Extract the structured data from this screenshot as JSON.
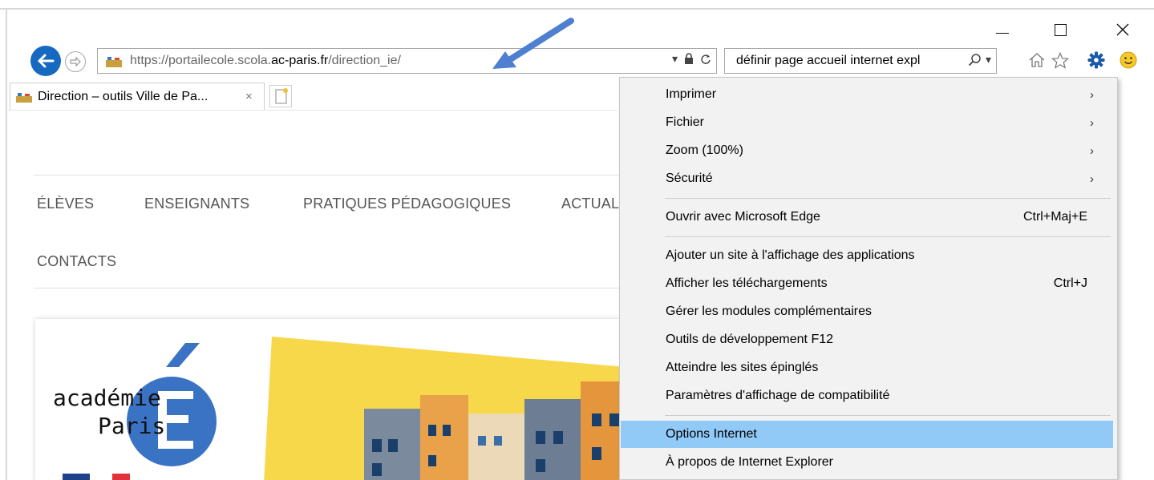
{
  "window": {
    "minimize_label": "—",
    "maximize_label": "☐",
    "close_label": "✕"
  },
  "address_bar": {
    "url_prefix": "https://portailecole.scola.",
    "url_domain": "ac-paris.fr",
    "url_suffix": "/direction_ie/"
  },
  "search_bar": {
    "value": "définir page accueil internet expl"
  },
  "tab": {
    "title": "Direction – outils Ville de Pa...",
    "close_label": "×"
  },
  "nav": {
    "items": [
      "ÉLÈVES",
      "ENSEIGNANTS",
      "PRATIQUES PÉDAGOGIQUES",
      "ACTUAL",
      "CONTACTS"
    ]
  },
  "banner": {
    "logo_line1": "académie",
    "logo_line2": "Paris"
  },
  "menu": {
    "items": [
      {
        "label": "Imprimer",
        "shortcut": "",
        "submenu": true
      },
      {
        "label": "Fichier",
        "shortcut": "",
        "submenu": true
      },
      {
        "label": "Zoom (100%)",
        "shortcut": "",
        "submenu": true
      },
      {
        "label": "Sécurité",
        "shortcut": "",
        "submenu": true
      },
      {
        "label": "Ouvrir avec Microsoft Edge",
        "shortcut": "Ctrl+Maj+E",
        "submenu": false
      },
      {
        "label": "Ajouter un site à l'affichage des applications",
        "shortcut": "",
        "submenu": false
      },
      {
        "label": "Afficher les téléchargements",
        "shortcut": "Ctrl+J",
        "submenu": false
      },
      {
        "label": "Gérer les modules complémentaires",
        "shortcut": "",
        "submenu": false
      },
      {
        "label": "Outils de développement F12",
        "shortcut": "",
        "submenu": false
      },
      {
        "label": "Atteindre les sites épinglés",
        "shortcut": "",
        "submenu": false
      },
      {
        "label": "Paramètres d'affichage de compatibilité",
        "shortcut": "",
        "submenu": false
      },
      {
        "label": "Options Internet",
        "shortcut": "",
        "submenu": false,
        "highlighted": true
      },
      {
        "label": "À propos de Internet Explorer",
        "shortcut": "",
        "submenu": false
      }
    ],
    "chevron": "›"
  },
  "icons": {
    "back": "back-arrow-icon",
    "forward": "forward-arrow-icon",
    "lock": "lock-icon",
    "refresh": "refresh-icon",
    "search": "search-icon",
    "home": "home-icon",
    "favorites": "star-icon",
    "tools": "gear-icon",
    "feedback": "smiley-icon"
  },
  "colors": {
    "accent_blue": "#1668c1",
    "menu_highlight": "#91c9f7",
    "menu_bg": "#f2f2f2",
    "banner_yellow": "#f7d84a",
    "annotation_arrow": "#4f7fd1"
  }
}
